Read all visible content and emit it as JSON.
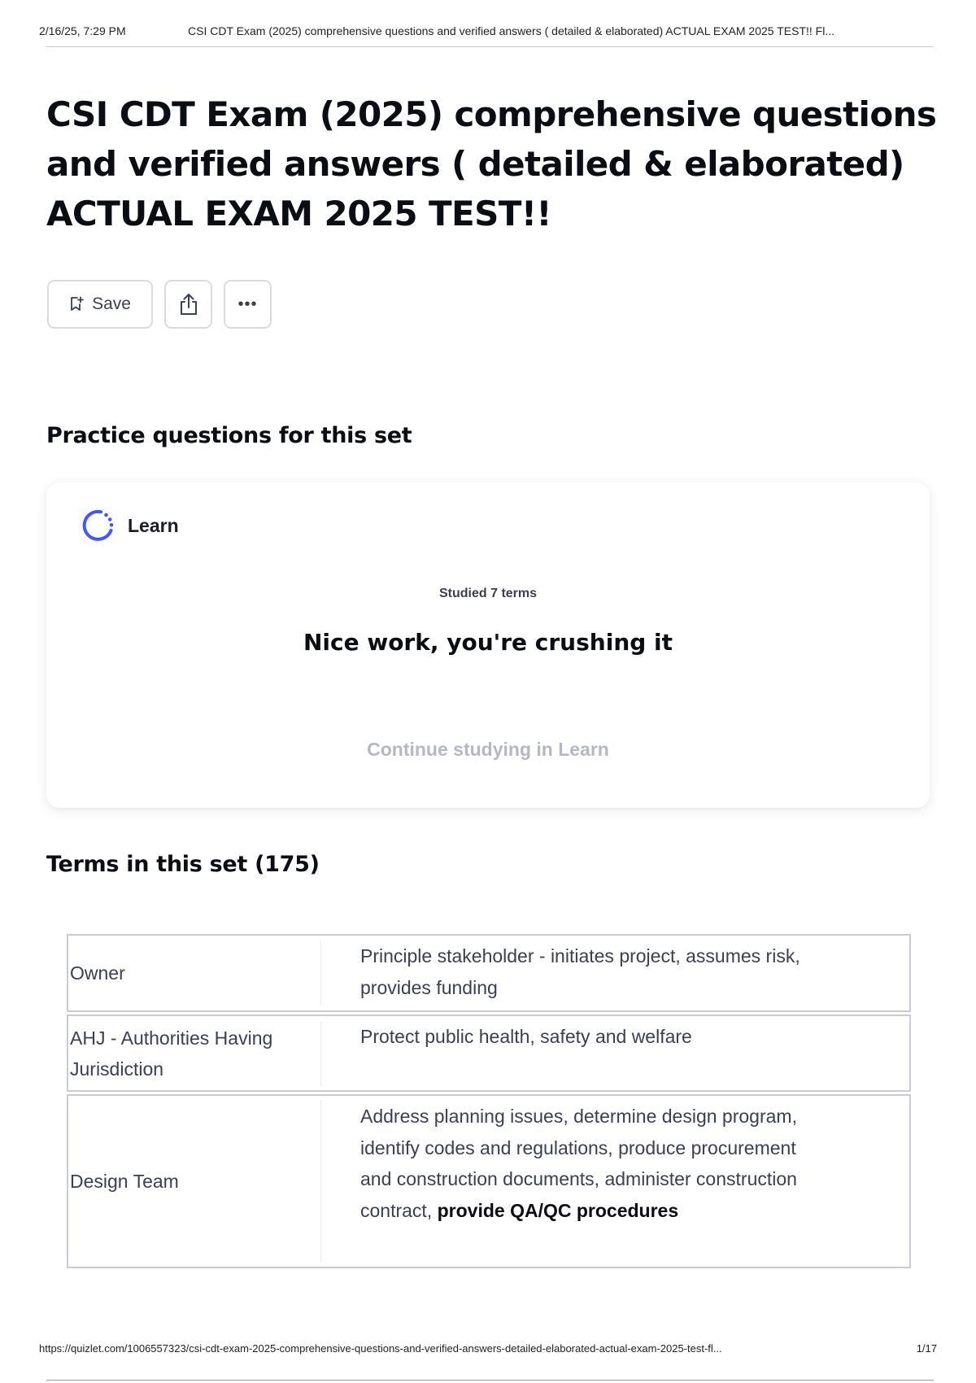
{
  "print_header": {
    "date": "2/16/25, 7:29 PM",
    "doc_title": "CSI CDT Exam (2025) comprehensive questions and verified answers ( detailed & elaborated) ACTUAL EXAM 2025 TEST!! Fl..."
  },
  "page": {
    "title": "CSI CDT Exam (2025) comprehensive questions and verified answers ( detailed & elaborated) ACTUAL EXAM 2025 TEST!!"
  },
  "toolbar": {
    "save_label": "Save",
    "save_icon": "bookmark-plus-icon",
    "share_icon": "share-icon",
    "more_label": "•••"
  },
  "practice": {
    "heading": "Practice questions for this set",
    "learn_label": "Learn",
    "studied_text": "Studied 7 terms",
    "message": "Nice work, you're crushing it",
    "continue_label": "Continue studying in Learn",
    "accent_color": "#4255ff"
  },
  "terms": {
    "heading": "Terms in this set (175)",
    "rows": [
      {
        "term": "Owner",
        "definition": "Principle stakeholder - initiates project, assumes risk, provides funding"
      },
      {
        "term": "AHJ - Authorities Having Jurisdiction",
        "definition": "Protect public health, safety and welfare"
      },
      {
        "term": "Design Team",
        "definition_start": "Address planning issues, determine design program, identify codes and regulations, produce procurement and construction documents, administer construction contract, ",
        "definition_bold": "provide QA/QC procedures"
      }
    ]
  },
  "print_footer": {
    "url": "https://quizlet.com/1006557323/csi-cdt-exam-2025-comprehensive-questions-and-verified-answers-detailed-elaborated-actual-exam-2025-test-fl...",
    "page_number": "1/17"
  }
}
